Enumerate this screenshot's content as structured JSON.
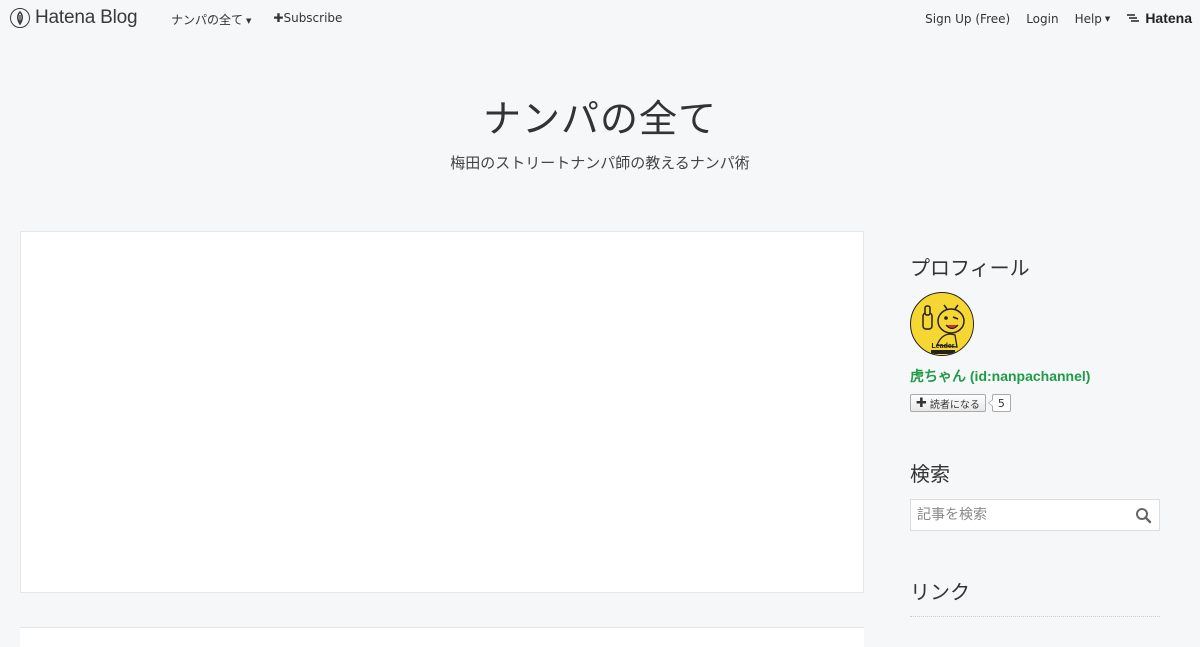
{
  "topbar": {
    "brand": "Hatena Blog",
    "blog_menu_label": "ナンパの全て",
    "subscribe_label": "Subscribe",
    "signup_label": "Sign Up (Free)",
    "login_label": "Login",
    "help_label": "Help",
    "hatena_label": "Hatena"
  },
  "header": {
    "title": "ナンパの全て",
    "description": "梅田のストリートナンパ師の教えるナンパ術"
  },
  "sidebar": {
    "profile": {
      "title": "プロフィール",
      "avatar_text": "Leader",
      "name": "虎ちゃん (id:nanpachannel)",
      "subscribe_label": "読者になる",
      "subscriber_count": "5"
    },
    "search": {
      "title": "検索",
      "placeholder": "記事を検索"
    },
    "links": {
      "title": "リンク"
    }
  },
  "colors": {
    "background": "#f6f7f8",
    "profile_name": "#1f9b47",
    "avatar": "#f5d632"
  }
}
